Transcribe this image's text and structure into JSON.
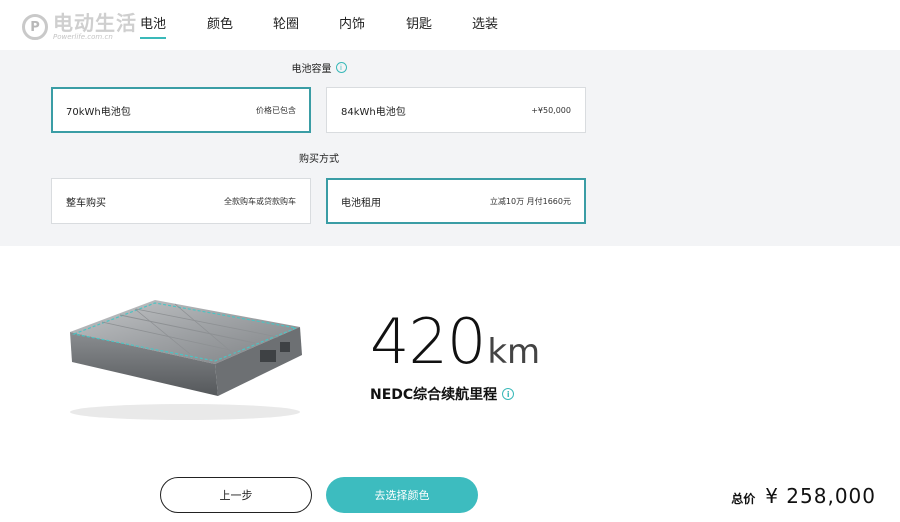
{
  "logo": {
    "mark": "P",
    "name": "电动生活",
    "url": "Powerlife.com.cn"
  },
  "tabs": [
    {
      "label": "电池",
      "active": true
    },
    {
      "label": "颜色",
      "active": false
    },
    {
      "label": "轮圈",
      "active": false
    },
    {
      "label": "内饰",
      "active": false
    },
    {
      "label": "钥匙",
      "active": false
    },
    {
      "label": "选装",
      "active": false
    }
  ],
  "capacity": {
    "title": "电池容量",
    "info": "i",
    "options": [
      {
        "label": "70kWh电池包",
        "note": "价格已包含",
        "selected": true
      },
      {
        "label": "84kWh电池包",
        "note": "+¥50,000",
        "selected": false
      }
    ]
  },
  "purchase": {
    "title": "购买方式",
    "options": [
      {
        "label": "整车购买",
        "note": "全款购车或贷款购车",
        "selected": false
      },
      {
        "label": "电池租用",
        "note": "立减10万 月付1660元",
        "selected": true
      }
    ]
  },
  "range": {
    "value": "420",
    "unit": "km",
    "label": "NEDC综合续航里程",
    "info": "i"
  },
  "footer": {
    "prev_label": "上一步",
    "next_label": "去选择颜色",
    "total_label": "总价",
    "total_value": "¥ 258,000"
  },
  "colors": {
    "accent": "#3ab9b9",
    "button": "#3dbcbf",
    "selected_border": "#3a9da5",
    "panel_bg": "#f3f4f6"
  }
}
